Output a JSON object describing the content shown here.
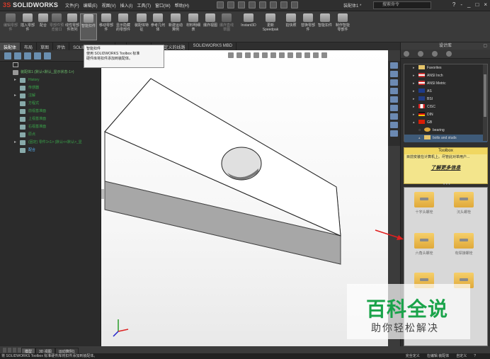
{
  "titlebar": {
    "app": "SOLIDWORKS",
    "menus": [
      "文件(F)",
      "编辑(E)",
      "视图(V)",
      "插入(I)",
      "工具(T)",
      "窗口(W)",
      "帮助(H)"
    ],
    "doc_title": "装配体1 *",
    "search_placeholder": "搜索命令",
    "controls": [
      "?",
      "-",
      "_",
      "□",
      "×"
    ]
  },
  "ribbon": {
    "buttons": [
      {
        "label": "编辑零部件",
        "enabled": false
      },
      {
        "label": "插入零部件",
        "enabled": true
      },
      {
        "label": "配合",
        "enabled": true
      },
      {
        "label": "零部件预览窗口",
        "enabled": false
      },
      {
        "label": "线性零部件阵列",
        "enabled": true
      },
      {
        "label": "智能扣件",
        "enabled": true,
        "active": true
      },
      {
        "label": "移动零部件",
        "enabled": true
      },
      {
        "label": "显示隐藏的零部件",
        "enabled": true
      },
      {
        "label": "装配体特征",
        "enabled": true
      },
      {
        "label": "参考几何体",
        "enabled": true
      },
      {
        "label": "新建运动算例",
        "enabled": true
      },
      {
        "label": "材料明细表",
        "enabled": true
      },
      {
        "label": "爆炸视图",
        "enabled": true
      },
      {
        "label": "爆炸直线草图",
        "enabled": false
      },
      {
        "label": "Instant3D",
        "enabled": true
      },
      {
        "label": "更新Speedpak",
        "enabled": true
      },
      {
        "label": "拍快照",
        "enabled": true
      },
      {
        "label": "替换零部件",
        "enabled": true
      },
      {
        "label": "智能扣件",
        "enabled": true
      },
      {
        "label": "制作智能零部件",
        "enabled": true
      }
    ]
  },
  "tabs": [
    "装配体",
    "布局",
    "草图",
    "评估",
    "SOLIDWORKS 插件",
    "...",
    "管理设计",
    "用户定义的线路",
    "SOLIDWORKS MBD"
  ],
  "tooltip": {
    "title": "智能扣件",
    "body_line1": "使用 SOLIDWORKS Toolbox 标准",
    "body_line2": "硬件库将扣件添加到装配体。"
  },
  "tree": {
    "root": "装配体1 (默认<默认_显示状态-1>)",
    "items": [
      {
        "label": "History",
        "expand": "▸"
      },
      {
        "label": "传感器",
        "expand": ""
      },
      {
        "label": "注解",
        "expand": "▸"
      },
      {
        "label": "方程式",
        "expand": ""
      },
      {
        "label": "前视基准面",
        "expand": ""
      },
      {
        "label": "上视基准面",
        "expand": ""
      },
      {
        "label": "右视基准面",
        "expand": ""
      },
      {
        "label": "原点",
        "expand": ""
      },
      {
        "label": "(固定) 零件1<1> (默认<<默认>_显",
        "expand": "▸"
      },
      {
        "label": "配合",
        "expand": "",
        "selected": true
      }
    ]
  },
  "bottom_tabs": [
    "模型",
    "3D 视图",
    "运动算例1"
  ],
  "taskpane": {
    "title": "设计库",
    "library": [
      {
        "label": "Favorites",
        "flag": "",
        "indent": false
      },
      {
        "label": "ANSI Inch",
        "flag": "us",
        "indent": false
      },
      {
        "label": "ANSI Metric",
        "flag": "us",
        "indent": false
      },
      {
        "label": "AS",
        "flag": "au",
        "indent": false
      },
      {
        "label": "BSI",
        "flag": "uk",
        "indent": false
      },
      {
        "label": "CISC",
        "flag": "ca",
        "indent": false
      },
      {
        "label": "DIN",
        "flag": "de",
        "indent": false
      },
      {
        "label": "GB",
        "flag": "cn",
        "indent": false,
        "expand": "▴"
      },
      {
        "label": "bearing",
        "flag": "",
        "indent": true
      },
      {
        "label": "bolts and studs",
        "flag": "",
        "indent": true,
        "selected": true
      }
    ],
    "toolbox": {
      "header": "Toolbox",
      "text": "目前安装在计算机上。尽管此对单用户...",
      "link": "了解更多信息"
    },
    "parts": [
      {
        "label": "十字头螺栓"
      },
      {
        "label": "沉头螺栓"
      },
      {
        "label": "六角头螺栓"
      },
      {
        "label": "有焊接螺栓"
      },
      {
        "label": ""
      },
      {
        "label": ""
      }
    ]
  },
  "statusbar": {
    "left": "将 SOLIDWORKS Toolbox 标准硬件库将扣件添加到装配体。",
    "right": [
      "完全定义",
      "在编辑 装配体",
      "自定义",
      "?"
    ]
  },
  "watermark": {
    "line1": "百科全说",
    "line2": "助你轻松解决"
  },
  "colors": {
    "tree_text": "#3aa64a",
    "selection": "#5ab6ff",
    "toolbox_bg": "#f3e58c",
    "arrow": "#e02020",
    "watermark": "#1aa34a"
  }
}
